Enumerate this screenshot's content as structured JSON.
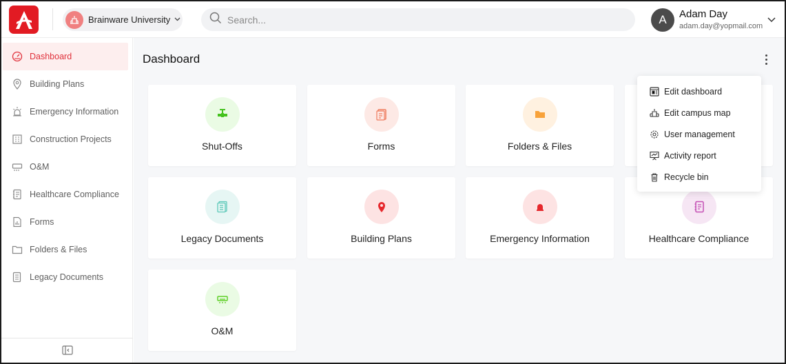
{
  "header": {
    "org": {
      "name": "Brainware University"
    },
    "search": {
      "placeholder": "Search..."
    },
    "user": {
      "initial": "A",
      "name": "Adam Day",
      "email": "adam.day@yopmail.com"
    }
  },
  "sidebar": {
    "items": [
      {
        "label": "Dashboard",
        "icon": "gauge-icon",
        "active": true
      },
      {
        "label": "Building Plans",
        "icon": "map-pin-icon"
      },
      {
        "label": "Emergency Information",
        "icon": "siren-icon"
      },
      {
        "label": "Construction Projects",
        "icon": "building-icon"
      },
      {
        "label": "O&M",
        "icon": "air-conditioner-icon"
      },
      {
        "label": "Healthcare Compliance",
        "icon": "notebook-icon"
      },
      {
        "label": "Forms",
        "icon": "form-icon"
      },
      {
        "label": "Folders & Files",
        "icon": "folder-icon"
      },
      {
        "label": "Legacy Documents",
        "icon": "documents-icon"
      }
    ],
    "collapse_icon": "collapse-sidebar-icon"
  },
  "main": {
    "title": "Dashboard",
    "cards": [
      {
        "title": "Shut-Offs",
        "icon": "valve-icon",
        "bg": "#eafbe4",
        "color": "#44c21e"
      },
      {
        "title": "Forms",
        "icon": "form-icon",
        "bg": "#fde9e5",
        "color": "#ee7b5d"
      },
      {
        "title": "Folders & Files",
        "icon": "folder-icon",
        "bg": "#fff1e0",
        "color": "#f8a23a"
      },
      {
        "title": "Legacy Documents",
        "icon": "documents-icon",
        "bg": "#e6f6f4",
        "color": "#5bc8b8"
      },
      {
        "title": "Building Plans",
        "icon": "map-pin-icon",
        "bg": "#fde3e3",
        "color": "#e6282d"
      },
      {
        "title": "Emergency Information",
        "icon": "siren-icon",
        "bg": "#fde3e3",
        "color": "#e6282d"
      },
      {
        "title": "Healthcare Compliance",
        "icon": "notebook-icon",
        "bg": "#f6e6f4",
        "color": "#c44fb4"
      },
      {
        "title": "O&M",
        "icon": "air-conditioner-icon",
        "bg": "#eafbe4",
        "color": "#5ecf26"
      }
    ]
  },
  "menu": {
    "items": [
      {
        "label": "Edit dashboard",
        "icon": "dashboard-edit-icon"
      },
      {
        "label": "Edit campus map",
        "icon": "campus-map-icon"
      },
      {
        "label": "User management",
        "icon": "gear-icon"
      },
      {
        "label": "Activity report",
        "icon": "chart-board-icon"
      },
      {
        "label": "Recycle bin",
        "icon": "trash-icon"
      }
    ]
  },
  "colors": {
    "brand": "#e21b23",
    "active_text": "#e0303a",
    "active_bg": "#fdeeee"
  }
}
